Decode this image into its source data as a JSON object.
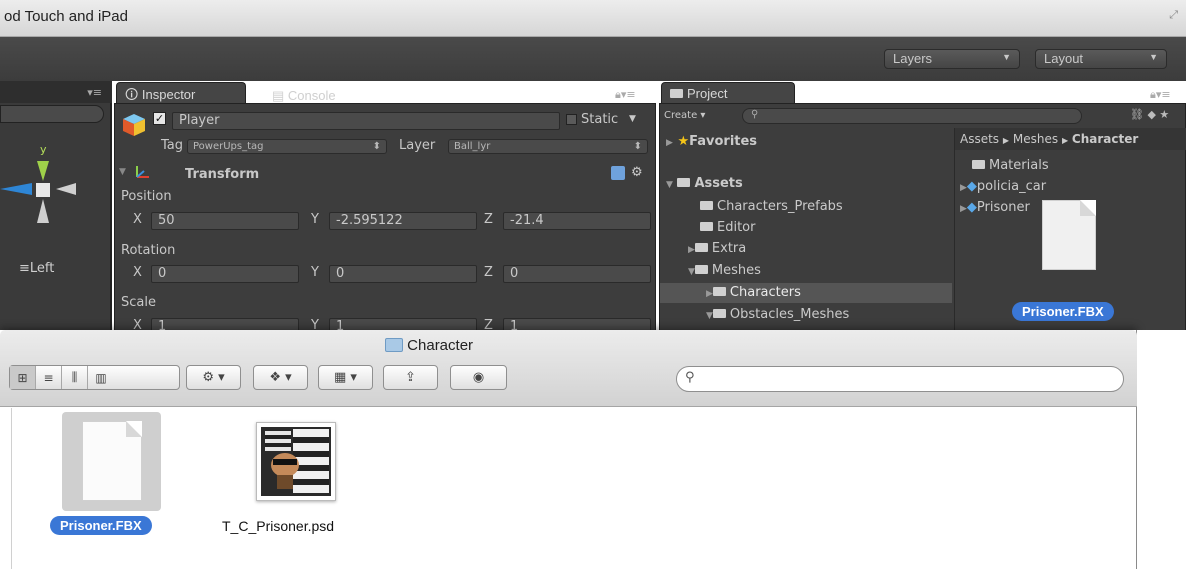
{
  "window": {
    "title": "od Touch and iPad"
  },
  "toolbar": {
    "layers_label": "Layers",
    "layout_label": "Layout"
  },
  "scene": {
    "axis_y": "y",
    "view_label": "Left"
  },
  "inspector": {
    "tab_inspector": "Inspector",
    "tab_console": "Console",
    "object_name": "Player",
    "static_label": "Static",
    "tag_label": "Tag",
    "tag_value": "PowerUps_tag",
    "layer_label": "Layer",
    "layer_value": "Ball_lyr",
    "component": "Transform",
    "position_label": "Position",
    "rotation_label": "Rotation",
    "scale_label": "Scale",
    "axis_x": "X",
    "axis_y": "Y",
    "axis_z": "Z",
    "position": {
      "x": "50",
      "y": "-2.595122",
      "z": "-21.4"
    },
    "rotation": {
      "x": "0",
      "y": "0",
      "z": "0"
    },
    "scale": {
      "x": "1",
      "y": "1",
      "z": "1"
    }
  },
  "project": {
    "tab": "Project",
    "create_label": "Create",
    "favorites": "Favorites",
    "assets": "Assets",
    "tree": [
      "Characters_Prefabs",
      "Editor",
      "Extra",
      "Meshes",
      "Characters",
      "Obstacles_Meshes"
    ],
    "breadcrumb": {
      "a": "Assets",
      "b": "Meshes",
      "c": "Character"
    },
    "items": [
      "Materials",
      "policia_car",
      "Prisoner"
    ],
    "selected_file": "Prisoner.FBX"
  },
  "finder": {
    "title": "Character",
    "files": [
      {
        "name": "Prisoner.FBX"
      },
      {
        "name": "T_C_Prisoner.psd"
      }
    ]
  }
}
